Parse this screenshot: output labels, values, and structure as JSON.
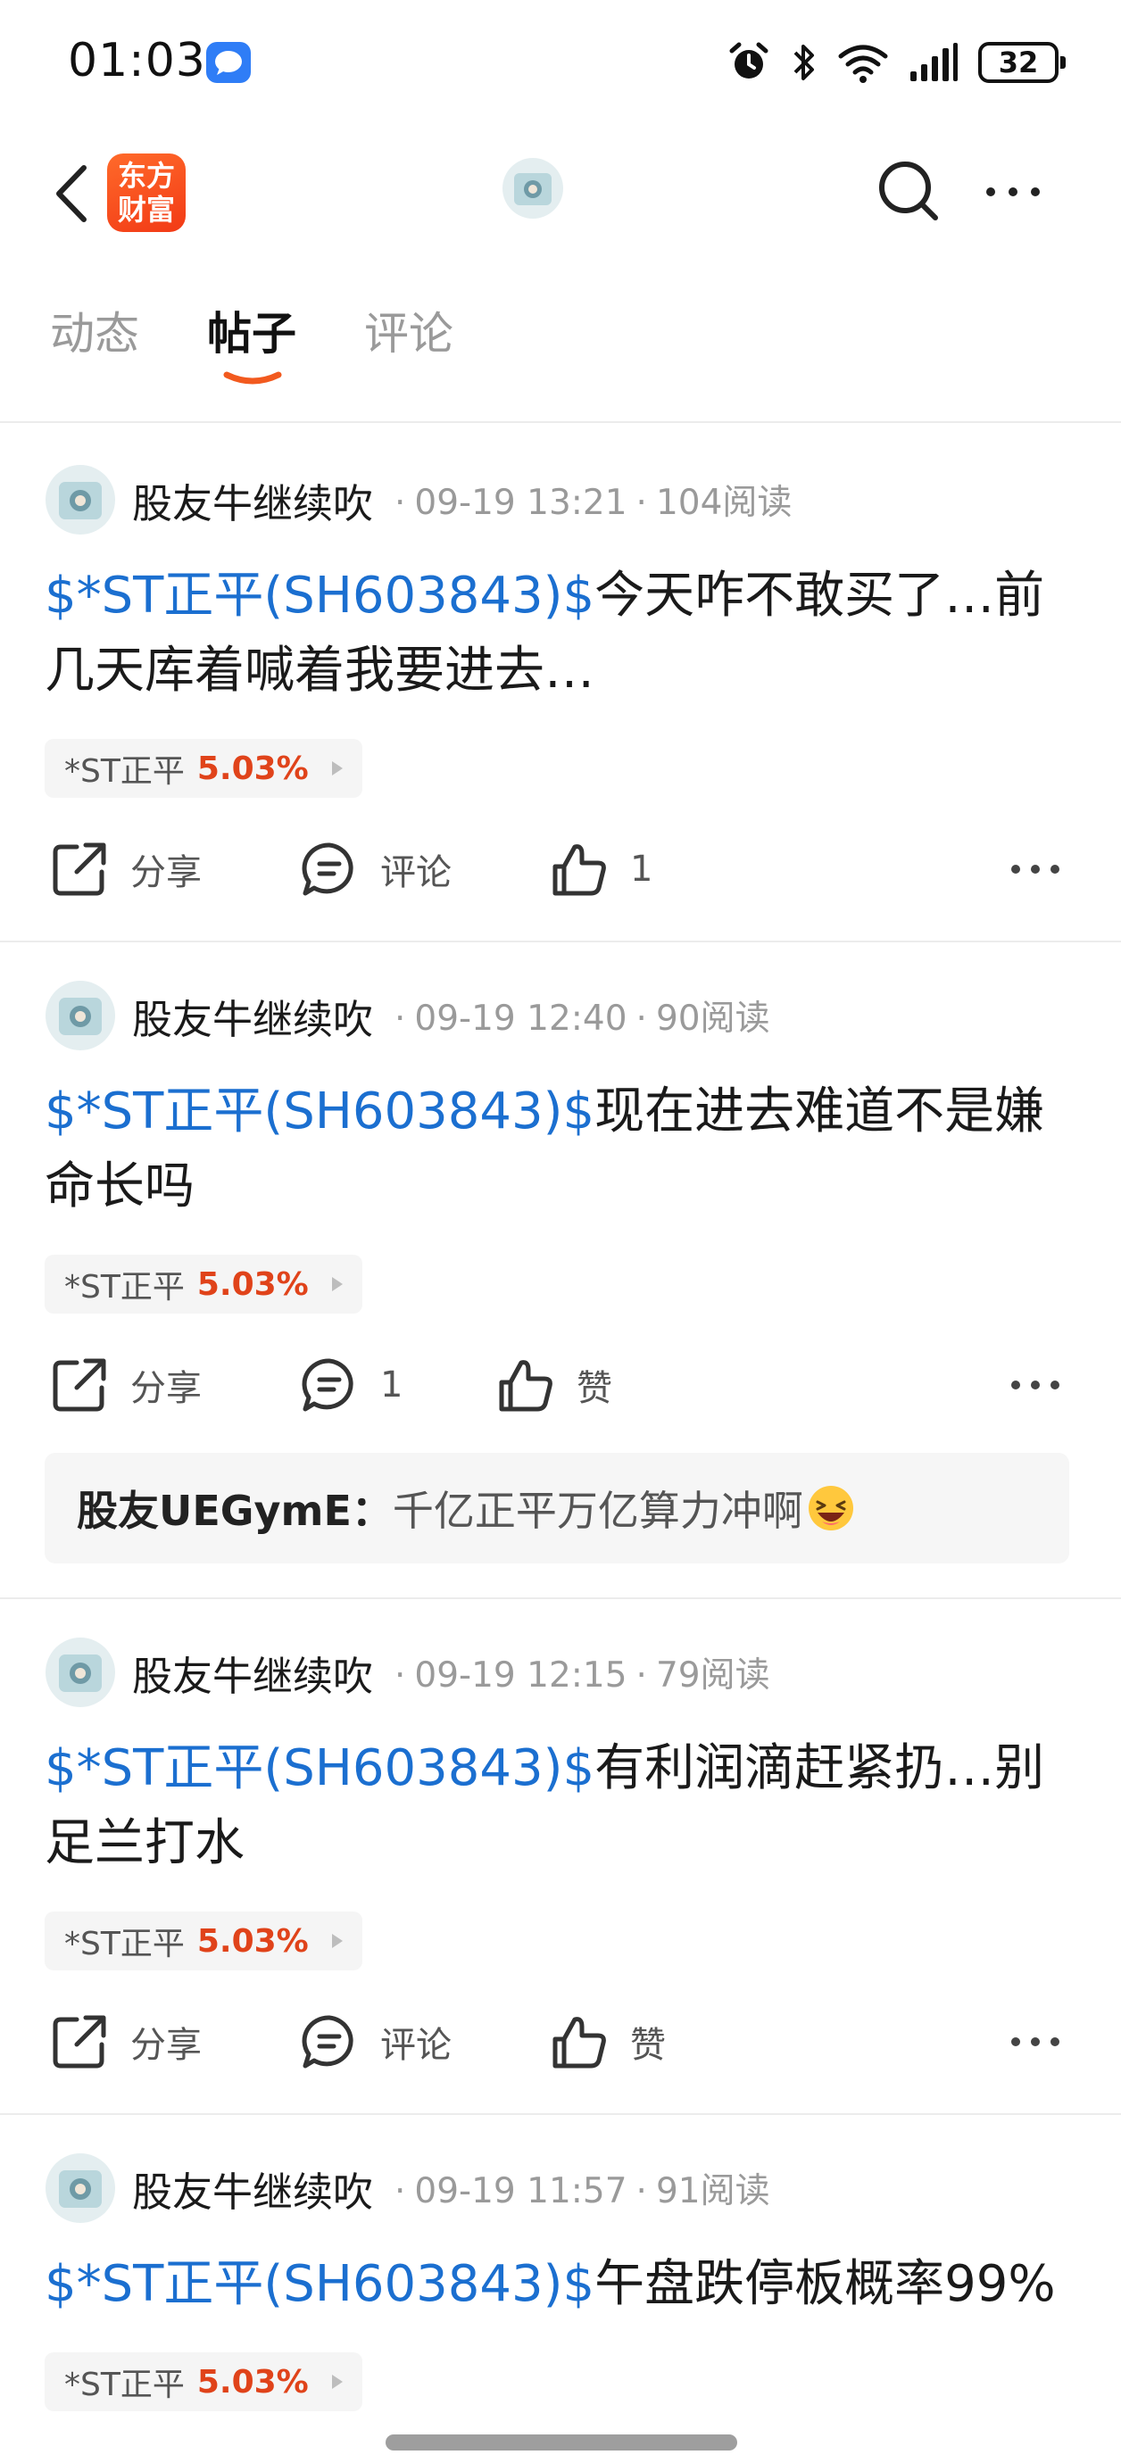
{
  "status_bar": {
    "time": "01:03",
    "battery": "32"
  },
  "header": {
    "logo_line1": "东方",
    "logo_line2": "财富"
  },
  "tabs": [
    {
      "label": "动态"
    },
    {
      "label": "帖子"
    },
    {
      "label": "评论"
    }
  ],
  "posts": [
    {
      "author": "股友牛继续吹",
      "time": "09-19 13:21",
      "reads": "104阅读",
      "stock_link": "$*ST正平(SH603843)$",
      "text": "今天咋不敢买了…前几天库着喊着我要进去…",
      "tag_name": "*ST正平",
      "tag_pct": "5.03%",
      "share_label": "分享",
      "comment_label": "评论",
      "like_label": "1"
    },
    {
      "author": "股友牛继续吹",
      "time": "09-19 12:40",
      "reads": "90阅读",
      "stock_link": "$*ST正平(SH603843)$",
      "text": "现在进去难道不是嫌命长吗",
      "tag_name": "*ST正平",
      "tag_pct": "5.03%",
      "share_label": "分享",
      "comment_label": "1",
      "like_label": "赞",
      "comment_preview": {
        "name": "股友UEGymE：",
        "text": "千亿正平万亿算力冲啊"
      }
    },
    {
      "author": "股友牛继续吹",
      "time": "09-19 12:15",
      "reads": "79阅读",
      "stock_link": "$*ST正平(SH603843)$",
      "text": "有利润滴赶紧扔…别足兰打水",
      "tag_name": "*ST正平",
      "tag_pct": "5.03%",
      "share_label": "分享",
      "comment_label": "评论",
      "like_label": "赞"
    },
    {
      "author": "股友牛继续吹",
      "time": "09-19 11:57",
      "reads": "91阅读",
      "stock_link": "$*ST正平(SH603843)$",
      "text": "午盘跌停板概率99%",
      "tag_name": "*ST正平",
      "tag_pct": "5.03%"
    }
  ]
}
